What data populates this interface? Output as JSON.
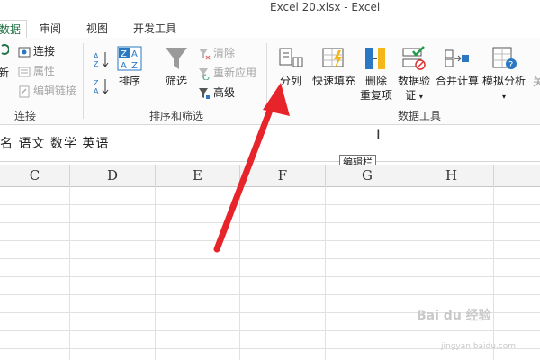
{
  "window": {
    "title": "Excel 20.xlsx - Excel"
  },
  "tabs": {
    "data": "数据",
    "review": "审阅",
    "view": "视图",
    "developer": "开发工具"
  },
  "connections": {
    "connect": "连接",
    "properties": "属性",
    "edit_links": "编辑链接",
    "refresh": "新",
    "group_label": "连接"
  },
  "sort_filter": {
    "sort": "排序",
    "filter": "筛选",
    "clear": "清除",
    "reapply": "重新应用",
    "advanced": "高级",
    "group_label": "排序和筛选"
  },
  "data_tools": {
    "split": "分列",
    "flash_fill": "快速填充",
    "remove_dup_1": "删除",
    "remove_dup_2": "重复项",
    "validation_1": "数据验",
    "validation_2": "证",
    "consolidate": "合并计算",
    "whatif": "模拟分析",
    "group_label": "数据工具"
  },
  "formula_bar": {
    "content": "名 语文 数学 英语"
  },
  "tooltip": "编辑栏",
  "columns": [
    "C",
    "D",
    "E",
    "F",
    "G",
    "H"
  ],
  "watermark": {
    "text": "Bai du 经验",
    "sub": "jingyan.baidu.com"
  },
  "colors": {
    "accent": "#217346",
    "arrow": "#e8242b"
  }
}
